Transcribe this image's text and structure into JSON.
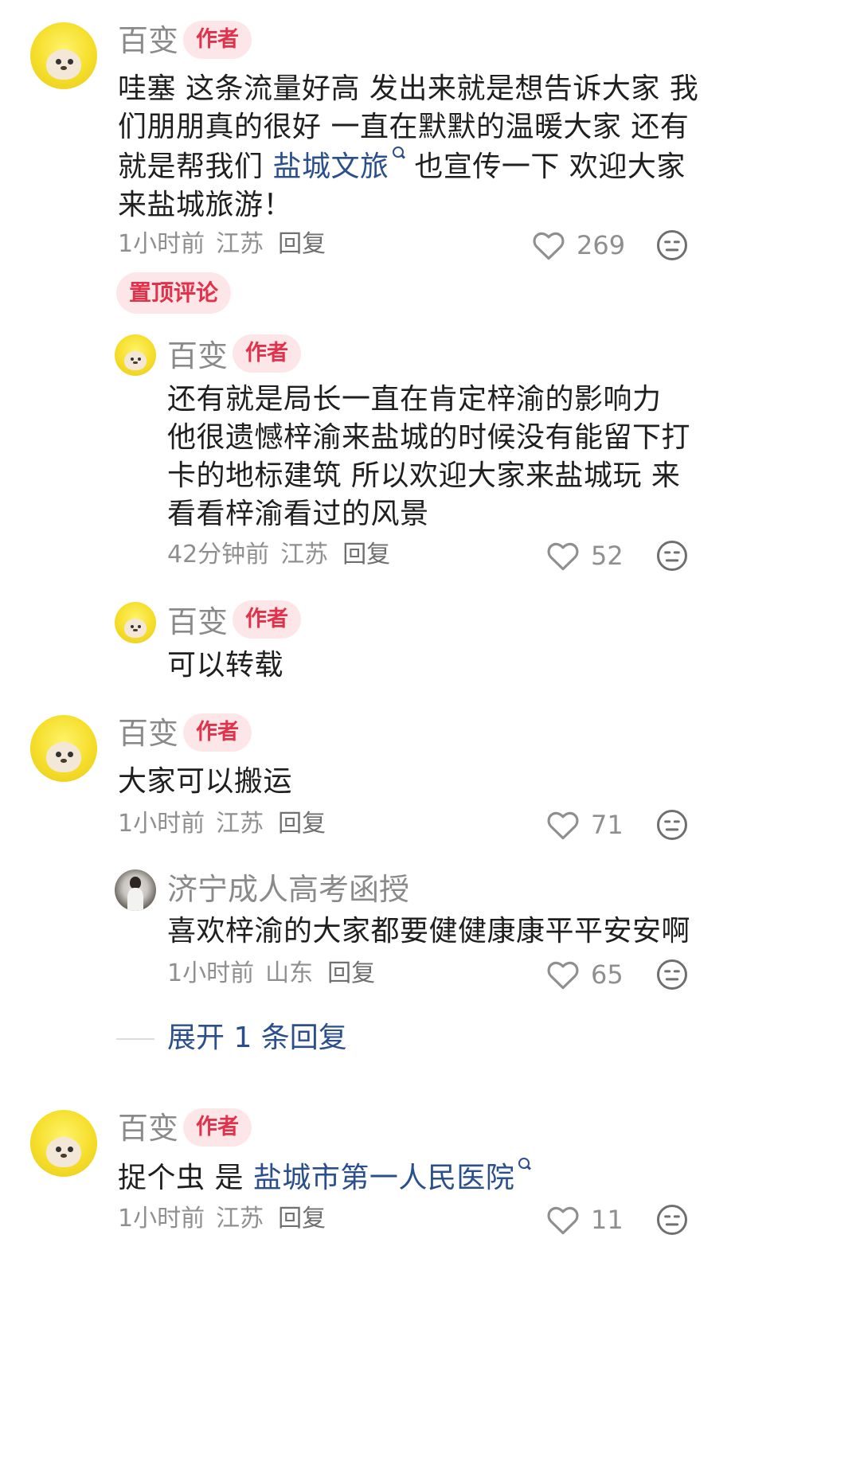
{
  "comments": [
    {
      "user": "百变",
      "badge": "作者",
      "text_parts": [
        "哇塞 这条流量好高 发出来就是想告诉大家 我们朋朋真的很好 一直在默默的温暖大家 还有就是帮我们 ",
        "盐城文旅",
        " 也宣传一下 欢迎大家来盐城旅游！"
      ],
      "time": "1小时前",
      "region": "江苏",
      "reply": "回复",
      "likes": "269"
    },
    {
      "pinned_label": "置顶评论"
    },
    {
      "user": "百变",
      "badge": "作者",
      "text": "还有就是局长一直在肯定梓渝的影响力 他很遗憾梓渝来盐城的时候没有能留下打卡的地标建筑 所以欢迎大家来盐城玩 来看看梓渝看过的风景",
      "time": "42分钟前",
      "region": "江苏",
      "reply": "回复",
      "likes": "52"
    },
    {
      "user": "百变",
      "badge": "作者",
      "text": "可以转载"
    },
    {
      "user": "百变",
      "badge": "作者",
      "text": "大家可以搬运",
      "time": "1小时前",
      "region": "江苏",
      "reply": "回复",
      "likes": "71"
    },
    {
      "user": "济宁成人高考函授",
      "text": "喜欢梓渝的大家都要健健康康平平安安啊",
      "time": "1小时前",
      "region": "山东",
      "reply": "回复",
      "likes": "65"
    },
    {
      "expand_label": "展开 1 条回复"
    },
    {
      "user": "百变",
      "badge": "作者",
      "text_parts": [
        "捉个虫 是 ",
        "盐城市第一人民医院"
      ],
      "time": "1小时前",
      "region": "江苏",
      "reply": "回复",
      "likes": "11"
    }
  ],
  "colors": {
    "link": "#2a4f8c",
    "badge_text": "#e2314a",
    "badge_bg": "#fde6e8"
  },
  "icons": {
    "like": "heart-outline-icon",
    "dislike": "neutral-face-icon",
    "link_search": "search-icon"
  }
}
